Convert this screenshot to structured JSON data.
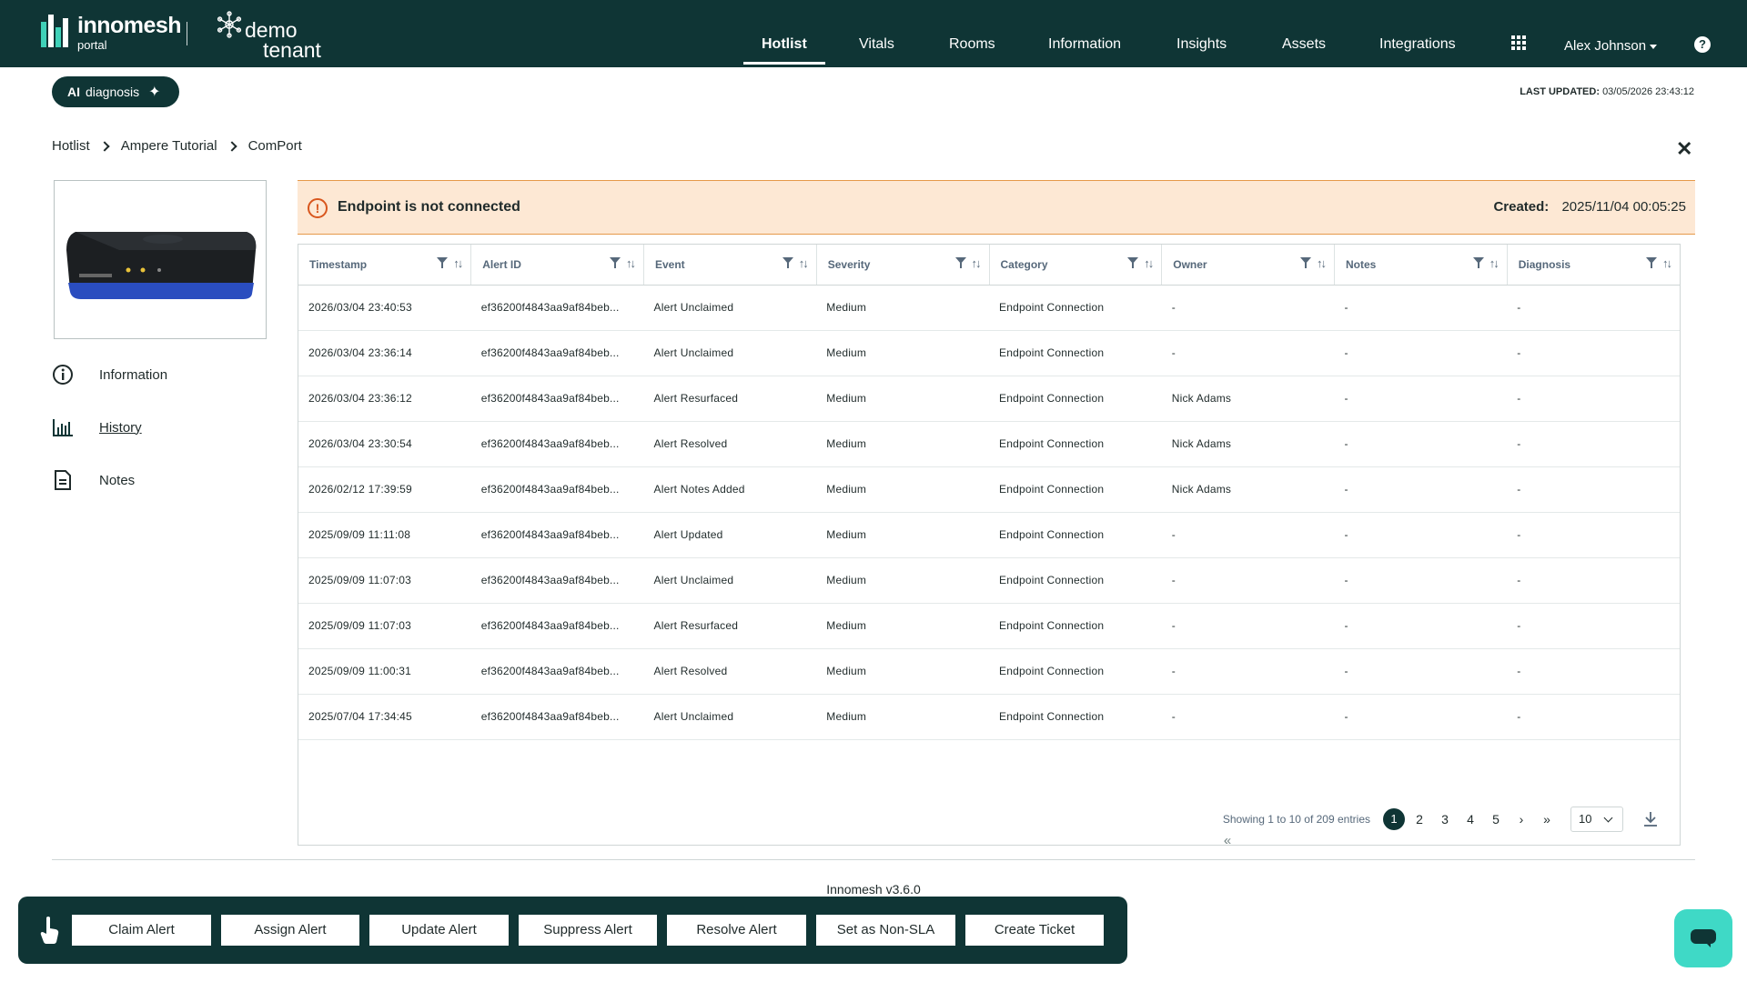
{
  "brand": {
    "name": "innomesh",
    "sub": "portal"
  },
  "tenant": {
    "line1": "demo",
    "line2": "tenant"
  },
  "nav": {
    "items": [
      {
        "label": "Hotlist"
      },
      {
        "label": "Vitals"
      },
      {
        "label": "Rooms"
      },
      {
        "label": "Information"
      },
      {
        "label": "Insights"
      },
      {
        "label": "Assets"
      },
      {
        "label": "Integrations"
      }
    ],
    "active": "Hotlist",
    "user": "Alex Johnson",
    "help": "?"
  },
  "ai": {
    "prefix": "AI",
    "label": "diagnosis"
  },
  "last_updated": {
    "label": "LAST UPDATED:",
    "value": "03/05/2026 23:43:12"
  },
  "breadcrumb": [
    "Hotlist",
    "Ampere Tutorial",
    "ComPort"
  ],
  "close": "✕",
  "sidebar": {
    "items": [
      {
        "label": "Information"
      },
      {
        "label": "History"
      },
      {
        "label": "Notes"
      }
    ],
    "active": "History"
  },
  "alert": {
    "message": "Endpoint is not connected",
    "created_label": "Created:",
    "created_value": "2025/11/04 00:05:25"
  },
  "table": {
    "columns": [
      "Timestamp",
      "Alert ID",
      "Event",
      "Severity",
      "Category",
      "Owner",
      "Notes",
      "Diagnosis"
    ],
    "rows": [
      [
        "2026/03/04 23:40:53",
        "ef36200f4843aa9af84beb...",
        "Alert Unclaimed",
        "Medium",
        "Endpoint Connection",
        "-",
        "-",
        "-"
      ],
      [
        "2026/03/04 23:36:14",
        "ef36200f4843aa9af84beb...",
        "Alert Unclaimed",
        "Medium",
        "Endpoint Connection",
        "-",
        "-",
        "-"
      ],
      [
        "2026/03/04 23:36:12",
        "ef36200f4843aa9af84beb...",
        "Alert Resurfaced",
        "Medium",
        "Endpoint Connection",
        "Nick Adams",
        "-",
        "-"
      ],
      [
        "2026/03/04 23:30:54",
        "ef36200f4843aa9af84beb...",
        "Alert Resolved",
        "Medium",
        "Endpoint Connection",
        "Nick Adams",
        "-",
        "-"
      ],
      [
        "2026/02/12 17:39:59",
        "ef36200f4843aa9af84beb...",
        "Alert Notes Added",
        "Medium",
        "Endpoint Connection",
        "Nick Adams",
        "-",
        "-"
      ],
      [
        "2025/09/09 11:11:08",
        "ef36200f4843aa9af84beb...",
        "Alert Updated",
        "Medium",
        "Endpoint Connection",
        "-",
        "-",
        "-"
      ],
      [
        "2025/09/09 11:07:03",
        "ef36200f4843aa9af84beb...",
        "Alert Unclaimed",
        "Medium",
        "Endpoint Connection",
        "-",
        "-",
        "-"
      ],
      [
        "2025/09/09 11:07:03",
        "ef36200f4843aa9af84beb...",
        "Alert Resurfaced",
        "Medium",
        "Endpoint Connection",
        "-",
        "-",
        "-"
      ],
      [
        "2025/09/09 11:00:31",
        "ef36200f4843aa9af84beb...",
        "Alert Resolved",
        "Medium",
        "Endpoint Connection",
        "-",
        "-",
        "-"
      ],
      [
        "2025/07/04 17:34:45",
        "ef36200f4843aa9af84beb...",
        "Alert Unclaimed",
        "Medium",
        "Endpoint Connection",
        "-",
        "-",
        "-"
      ]
    ]
  },
  "pagination": {
    "info": "Showing 1 to 10 of 209 entries",
    "first": "«",
    "prev": "‹",
    "pages": [
      "1",
      "2",
      "3",
      "4",
      "5"
    ],
    "current": "1",
    "next": "›",
    "last": "»",
    "page_size": "10"
  },
  "version": "Innomesh v3.6.0",
  "actions": [
    "Claim Alert",
    "Assign Alert",
    "Update Alert",
    "Suppress Alert",
    "Resolve Alert",
    "Set as Non-SLA",
    "Create Ticket"
  ],
  "colors": {
    "nav_bg": "#0f3535",
    "accent": "#3fd9c6",
    "banner_bg": "#fde8d4",
    "banner_border": "#e6994a",
    "warning": "#d8561d"
  }
}
